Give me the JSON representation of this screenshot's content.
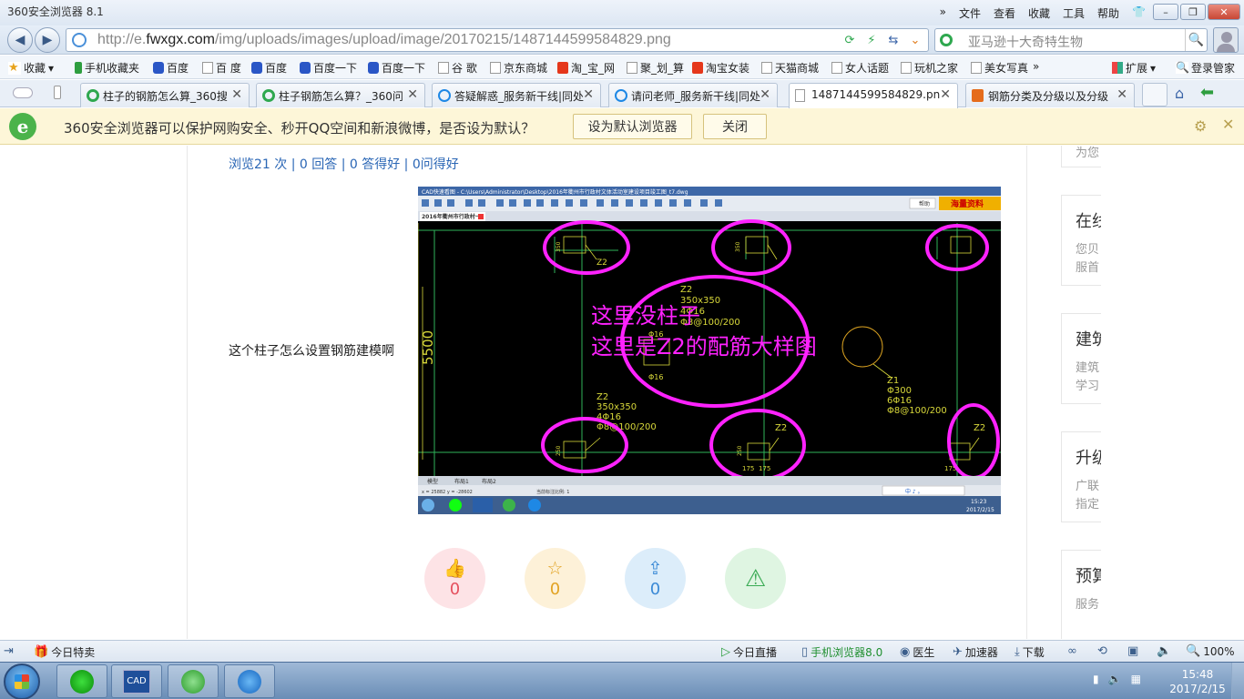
{
  "window": {
    "title": "360安全浏览器 8.1",
    "menu": [
      "文件",
      "查看",
      "收藏",
      "工具",
      "帮助"
    ]
  },
  "address": {
    "url_prefix": "http://e.",
    "url_domain": "fwxgx.com",
    "url_path": "/img/uploads/images/upload/image/20170215/1487144599584829.png",
    "search_text": "亚马逊十大奇特生物"
  },
  "bookmarks": {
    "items": [
      {
        "label": "收藏",
        "icon": "star-icon"
      },
      {
        "label": "手机收藏夹",
        "icon": "phone-icon"
      },
      {
        "label": "百度",
        "icon": "baidu-paw-icon"
      },
      {
        "label": "百 度",
        "icon": "page-icon"
      },
      {
        "label": "百度",
        "icon": "baidu-paw-icon"
      },
      {
        "label": "百度一下",
        "icon": "baidu-paw-icon"
      },
      {
        "label": "百度一下",
        "icon": "baidu-paw-icon"
      },
      {
        "label": "谷 歌",
        "icon": "page-icon"
      },
      {
        "label": "京东商城",
        "icon": "page-icon"
      },
      {
        "label": "淘_宝_网",
        "icon": "taobao-icon"
      },
      {
        "label": "聚_划_算",
        "icon": "page-icon"
      },
      {
        "label": "淘宝女装",
        "icon": "taobao-icon"
      },
      {
        "label": "天猫商城",
        "icon": "page-icon"
      },
      {
        "label": "女人话题",
        "icon": "page-icon"
      },
      {
        "label": "玩机之家",
        "icon": "page-icon"
      },
      {
        "label": "美女写真",
        "icon": "page-icon"
      }
    ],
    "more": "»",
    "extend": "扩展",
    "login": "登录管家"
  },
  "tabs": [
    {
      "label": "柱子的钢筋怎么算_360搜",
      "icon": "360-search-icon"
    },
    {
      "label": "柱子钢筋怎么算？_360问",
      "icon": "360-search-icon"
    },
    {
      "label": "答疑解惑_服务新干线|同处",
      "icon": "ie-icon"
    },
    {
      "label": "请问老师_服务新干线|同处",
      "icon": "ie-icon"
    },
    {
      "label": "1487144599584829.pn",
      "icon": "document-icon",
      "active": true
    },
    {
      "label": "钢筋分类及分级以及分级",
      "icon": "box-icon"
    }
  ],
  "notification": {
    "message": "360安全浏览器可以保护网购安全、秒开QQ空间和新浪微博，是否设为默认？",
    "default_button": "设为默认浏览器",
    "close_button": "关闭"
  },
  "page": {
    "stats": "浏览21 次 | 0 回答 | 0 答得好 | 0问得好",
    "question": "这个柱子怎么设置钢筋建模啊",
    "actions": {
      "like": "0",
      "favorite": "0",
      "share": "0"
    }
  },
  "cad": {
    "title": "CAD快速看图 - C:\\Users\\Administrator\\Desktop\\2016年衢州市行政村文体活动室建设项目竣工图_t7.dwg",
    "help": "帮助",
    "ad": "海量资料",
    "doc_tab": "2016年衢州市行政村一",
    "dimension": "5500",
    "annotation_line1": "这里没柱子",
    "annotation_line2": "这里是Z2的配筋大样图",
    "z2_label": "Z2",
    "z2_size": "350x350",
    "z2_bars": "4Φ16",
    "z2_stirrup": "Φ8@100/200",
    "phi16": "Φ16",
    "z1_label": "Z1",
    "z1_size": "Φ300",
    "z1_bars": "6Φ16",
    "z1_stirrup": "Φ8@100/200",
    "dim_350": "350",
    "dim_250": "250",
    "dim_175": "175",
    "layout_tabs": [
      "模型",
      "布局1",
      "布局2"
    ],
    "status_coords": "x = 25882  y = -28602",
    "status_scale": "当前标注比例: 1",
    "taskbar_time": "15:23",
    "taskbar_date": "2017/2/15",
    "ime": "中 ♪ 。"
  },
  "sidebar": {
    "cards": [
      {
        "title": "",
        "line1": "为您",
        "line2": ""
      },
      {
        "title": "在线",
        "line1": "您贝",
        "line2": "服首"
      },
      {
        "title": "建筑",
        "line1": "建筑",
        "line2": "学习"
      },
      {
        "title": "升级",
        "line1": "广联",
        "line2": "指定"
      },
      {
        "title": "预算",
        "line1": "服务",
        "line2": ""
      }
    ]
  },
  "statusbar": {
    "left": "今日特卖",
    "live": "今日直播",
    "mobile": "手机浏览器8.0",
    "doctor": "医生",
    "accelerator": "加速器",
    "download": "下载",
    "zoom": "100%"
  },
  "taskbar": {
    "cad_label": "CAD",
    "time": "15:48",
    "date": "2017/2/15"
  },
  "colors": {
    "link": "#2a66b5",
    "annotation": "#ff22ff",
    "cad_yellow": "#d8d83a",
    "cad_green": "#2fb35a"
  }
}
